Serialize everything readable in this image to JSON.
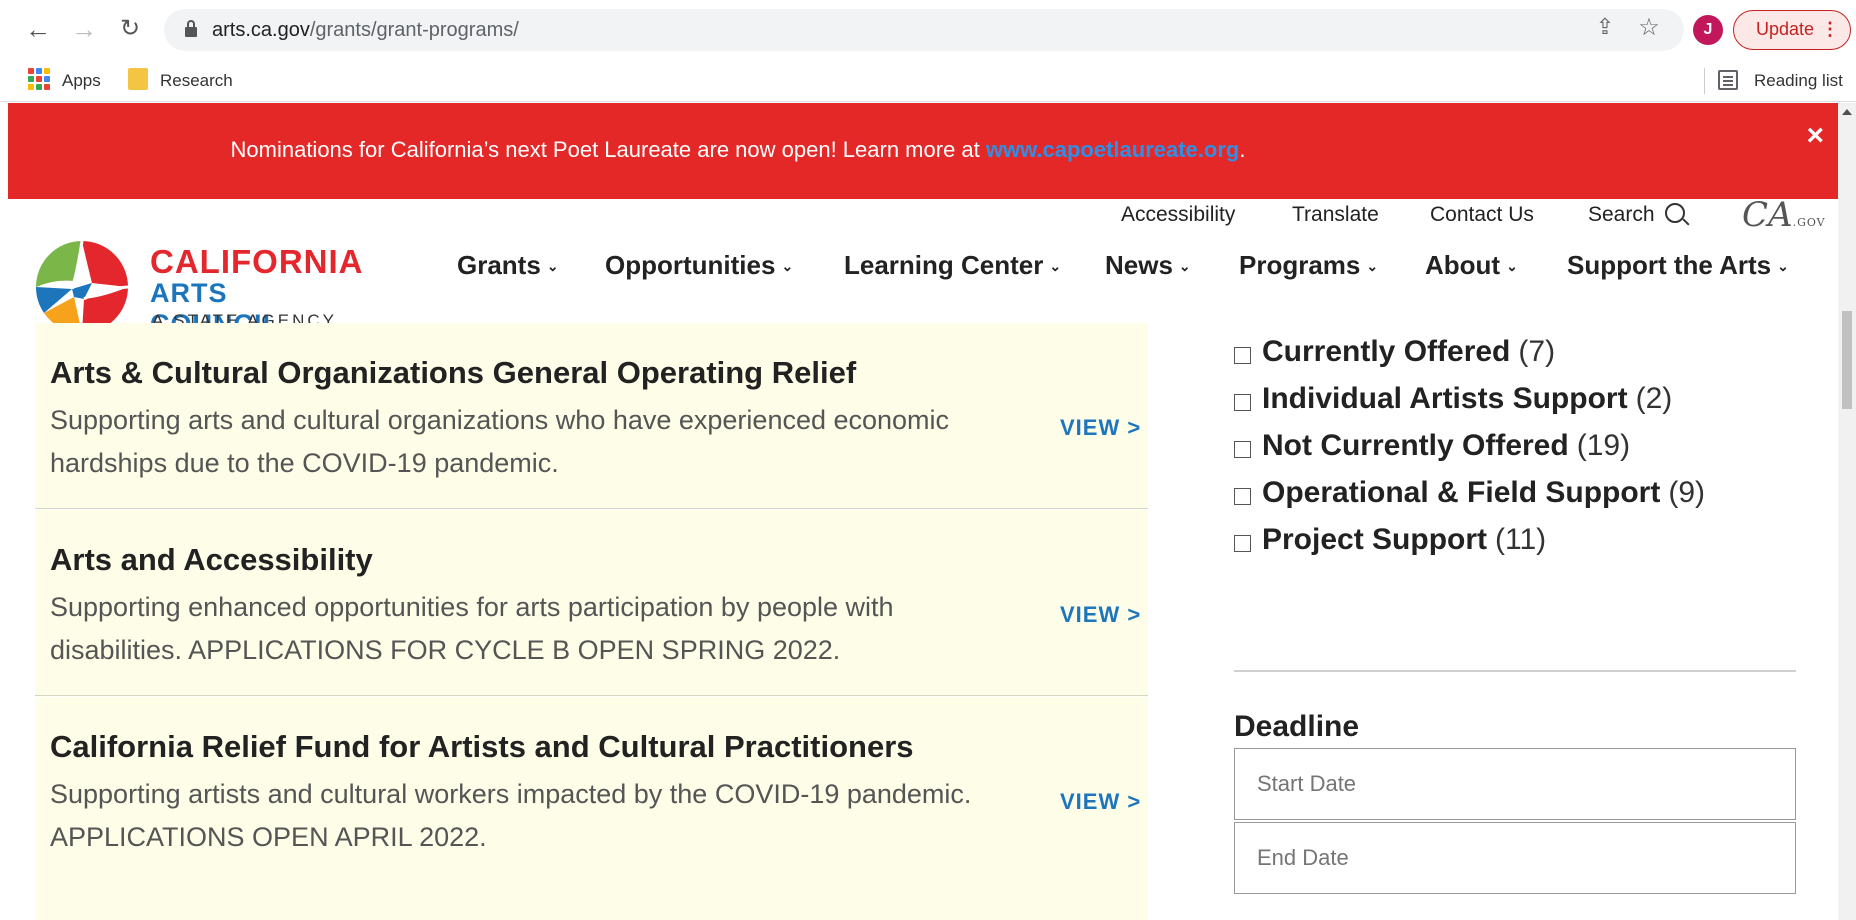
{
  "browser": {
    "url_host": "arts.ca.gov",
    "url_path": "/grants/grant-programs/",
    "avatar_initial": "J",
    "update_label": "Update",
    "update_dots": "⋮",
    "bookmarks": [
      {
        "label": "Apps",
        "icon": "apps-grid-icon"
      },
      {
        "label": "Research",
        "icon": "folder-icon"
      }
    ],
    "reading_list_label": "Reading list",
    "icons": {
      "back": "←",
      "forward": "→",
      "reload": "↻",
      "share": "⇪",
      "star": "☆"
    }
  },
  "alert": {
    "message": "Nominations for California’s next Poet Laureate are now open! Learn more at ",
    "link_text": "www.capoetlaureate.org",
    "suffix": ".",
    "close": "×"
  },
  "logo": {
    "line1": "CALIFORNIA",
    "line2": "ARTS COUNCIL",
    "line3": "A STATE AGENCY"
  },
  "utility_nav": [
    "Accessibility",
    "Translate",
    "Contact Us",
    "Search"
  ],
  "ca_gov": {
    "script": "CA",
    "suffix": ".GOV"
  },
  "main_nav": [
    "Grants",
    "Opportunities",
    "Learning Center",
    "News",
    "Programs",
    "About",
    "Support the Arts"
  ],
  "grants": [
    {
      "title": "Arts & Cultural Organizations General Operating Relief",
      "desc": "Supporting arts and cultural organizations who have experienced economic hardships due to the COVID-19 pandemic.",
      "view": "VIEW >"
    },
    {
      "title": "Arts and Accessibility",
      "desc": "Supporting enhanced opportunities for arts participation by people with disabilities. APPLICATIONS FOR CYCLE B OPEN SPRING 2022.",
      "view": "VIEW >"
    },
    {
      "title": "California Relief Fund for Artists and Cultural Practitioners",
      "desc": "Supporting artists and cultural workers impacted by the COVID-19 pandemic. APPLICATIONS OPEN APRIL 2022.",
      "view": "VIEW >"
    }
  ],
  "filters": [
    {
      "label": "Currently Offered",
      "count": "(7)"
    },
    {
      "label": "Individual Artists Support",
      "count": "(2)"
    },
    {
      "label": "Not Currently Offered",
      "count": "(19)"
    },
    {
      "label": "Operational & Field Support",
      "count": "(9)"
    },
    {
      "label": "Project Support",
      "count": "(11)"
    }
  ],
  "deadline": {
    "heading": "Deadline",
    "start_placeholder": "Start Date",
    "end_placeholder": "End Date"
  },
  "colors": {
    "alert_bg": "#e42828",
    "brand_red": "#e4262d",
    "brand_blue": "#1d75bc",
    "card_bg": "#fdfde8"
  }
}
